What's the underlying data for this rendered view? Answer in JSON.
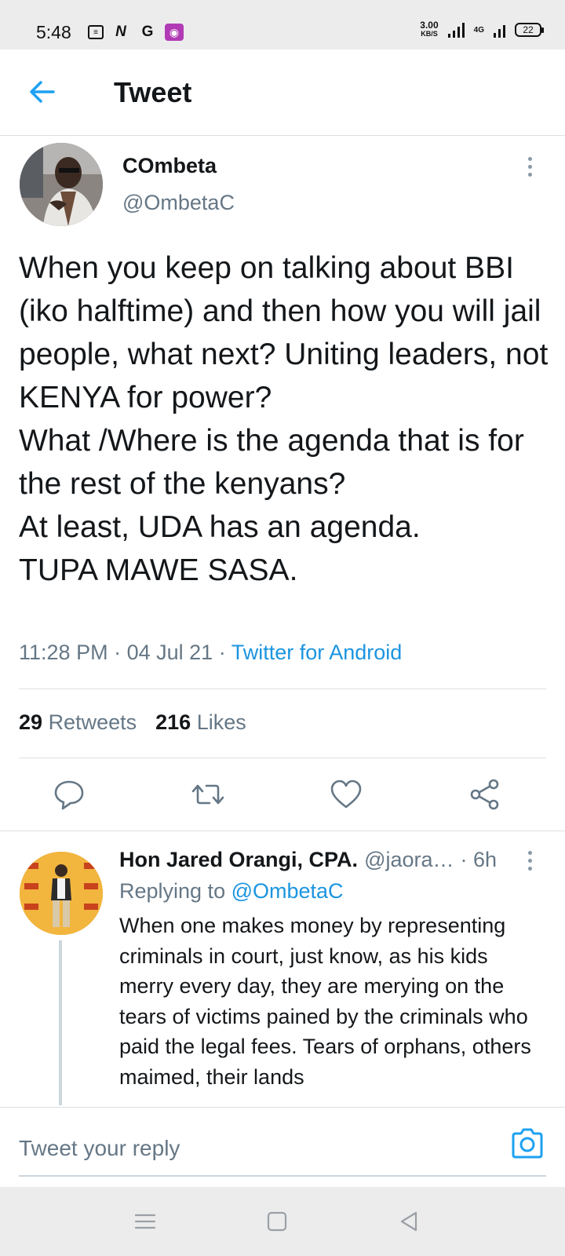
{
  "status_bar": {
    "time": "5:48",
    "icons": [
      "notes-icon",
      "n-app-icon",
      "google-icon",
      "podcast-app-icon"
    ],
    "speed_value": "3.00",
    "speed_unit": "KB/S",
    "network": "4G",
    "battery": "22"
  },
  "header": {
    "title": "Tweet"
  },
  "tweet": {
    "author_name": "COmbeta",
    "author_handle": "@OmbetaC",
    "text": "When you keep on talking about BBI (iko halftime) and then how you will jail people,  what next? Uniting leaders, not KENYA for power?\nWhat /Where is the agenda that is for the rest of the kenyans?\nAt least,  UDA has an agenda.\nTUPA MAWE SASA.",
    "time": "11:28 PM",
    "date": "04 Jul 21",
    "source": "Twitter for Android",
    "retweets_count": "29",
    "retweets_label": "Retweets",
    "likes_count": "216",
    "likes_label": "Likes"
  },
  "reply": {
    "author_name": "Hon Jared Orangi, CPA.",
    "author_handle": "@jaora…",
    "time": "· 6h",
    "replying_label": "Replying to",
    "replying_to": "@OmbetaC",
    "text": "When one makes money by representing criminals in court, just know, as his kids merry every day, they are merying on the tears of victims pained by the criminals who paid the legal fees. Tears of orphans, others maimed, their lands"
  },
  "composer": {
    "placeholder": "Tweet your reply"
  },
  "colors": {
    "accent": "#1b95e0",
    "secondary_text": "#657786",
    "primary_text": "#14171a"
  }
}
